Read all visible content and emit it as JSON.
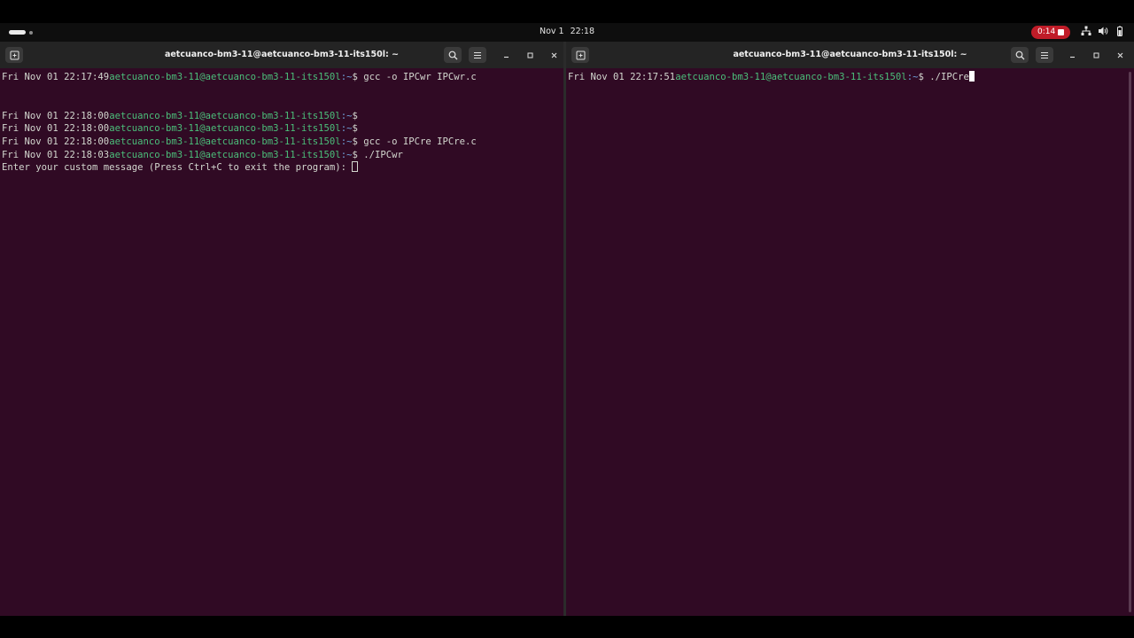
{
  "topbar": {
    "date": "Nov 1",
    "time": "22:18",
    "recording_time": "0:14"
  },
  "left_window": {
    "title": "aetcuanco-bm3-11@aetcuanco-bm3-11-its150l: ~",
    "lines": [
      {
        "time": "Fri Nov 01 22:17:49",
        "host": "aetcuanco-bm3-11@aetcuanco-bm3-11-its150l",
        "path": ":~",
        "prompt": "$ ",
        "cmd": "gcc -o IPCwr IPCwr.c"
      },
      {
        "blank": true
      },
      {
        "blank": true
      },
      {
        "time": "Fri Nov 01 22:18:00",
        "host": "aetcuanco-bm3-11@aetcuanco-bm3-11-its150l",
        "path": ":~",
        "prompt": "$ ",
        "cmd": ""
      },
      {
        "time": "Fri Nov 01 22:18:00",
        "host": "aetcuanco-bm3-11@aetcuanco-bm3-11-its150l",
        "path": ":~",
        "prompt": "$ ",
        "cmd": ""
      },
      {
        "time": "Fri Nov 01 22:18:00",
        "host": "aetcuanco-bm3-11@aetcuanco-bm3-11-its150l",
        "path": ":~",
        "prompt": "$ ",
        "cmd": "gcc -o IPCre IPCre.c"
      },
      {
        "time": "Fri Nov 01 22:18:03",
        "host": "aetcuanco-bm3-11@aetcuanco-bm3-11-its150l",
        "path": ":~",
        "prompt": "$ ",
        "cmd": "./IPCwr"
      },
      {
        "text": "Enter your custom message (Press Ctrl+C to exit the program): ",
        "cursor": "box"
      }
    ]
  },
  "right_window": {
    "title": "aetcuanco-bm3-11@aetcuanco-bm3-11-its150l: ~",
    "lines": [
      {
        "time": "Fri Nov 01 22:17:51",
        "host": "aetcuanco-bm3-11@aetcuanco-bm3-11-its150l",
        "path": ":~",
        "prompt": "$ ",
        "cmd": "./IPCre",
        "cursor": "solid"
      }
    ]
  },
  "colors": {
    "terminal_bg": "#300a24",
    "host_green": "#4bbf7a",
    "path_blue": "#6fa0d8",
    "record_red": "#c01c28"
  },
  "icons": [
    "activities-indicator",
    "record-stop-icon",
    "network-icon",
    "volume-icon",
    "battery-icon",
    "new-tab-icon",
    "search-icon",
    "hamburger-menu-icon",
    "minimize-icon",
    "maximize-icon",
    "close-icon"
  ]
}
